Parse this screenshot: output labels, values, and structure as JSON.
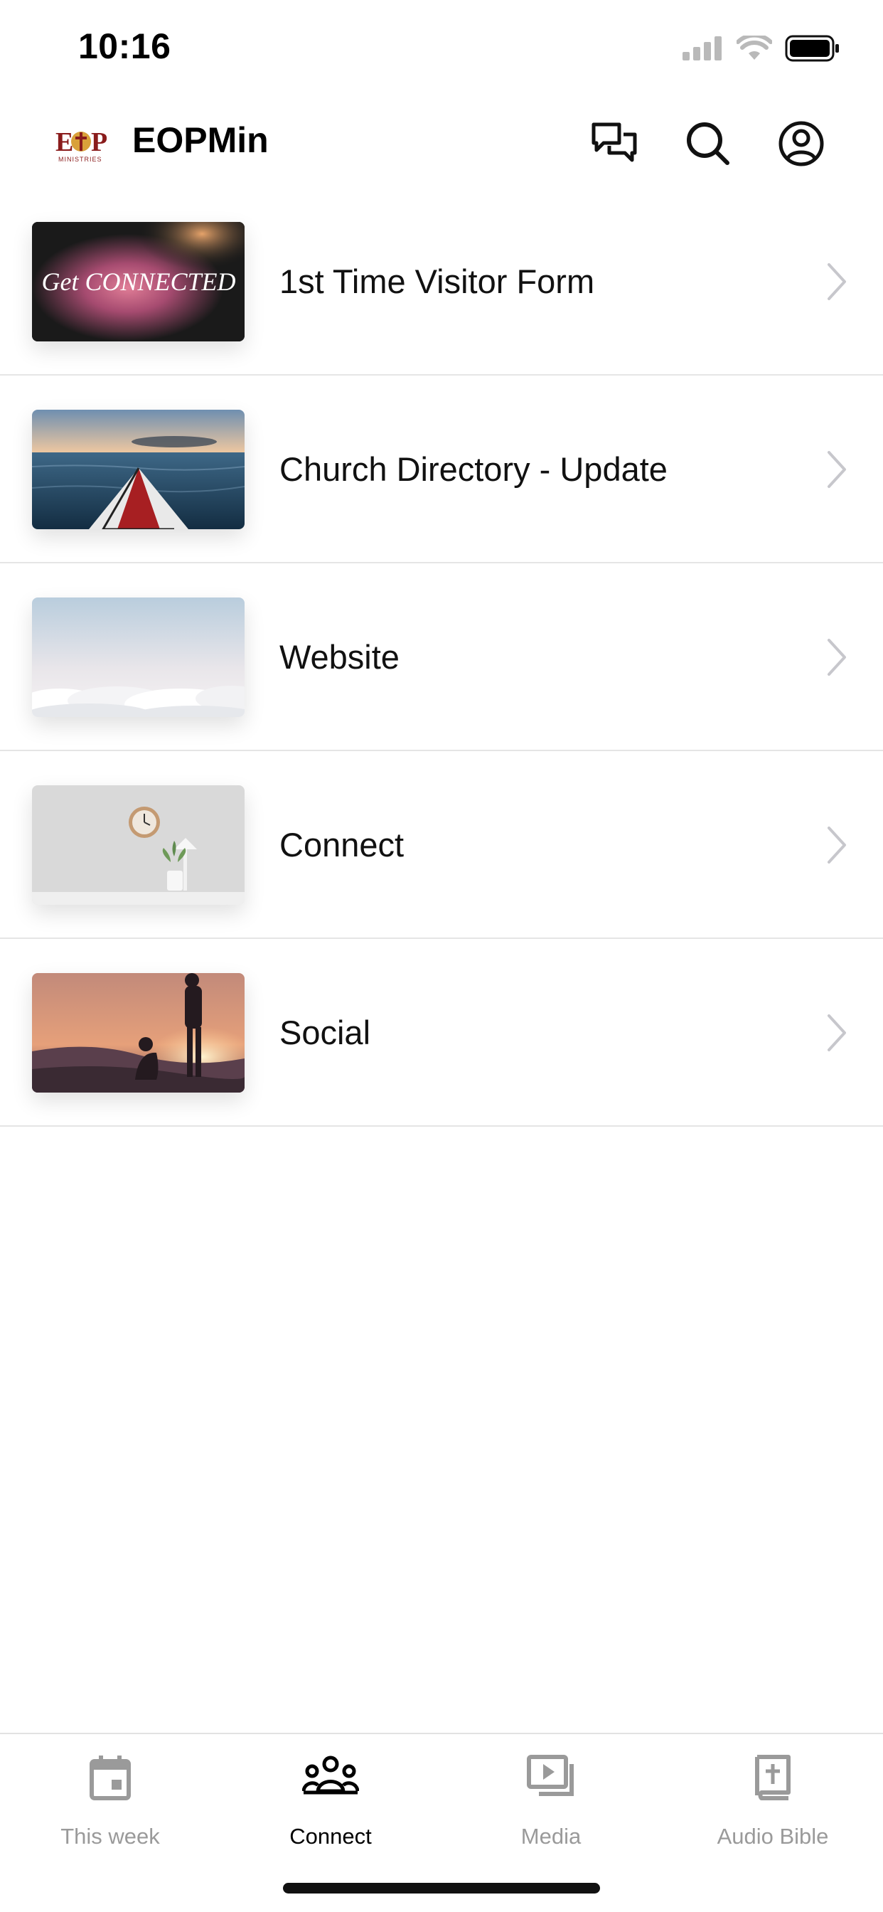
{
  "status_bar": {
    "time": "10:16",
    "icons": [
      "signal-icon",
      "wifi-icon",
      "battery-icon"
    ]
  },
  "header": {
    "logo_text": "EOP",
    "logo_subtext": "MINISTRIES",
    "title": "EOPMin",
    "actions": [
      "chat-icon",
      "search-icon",
      "account-icon"
    ]
  },
  "list": {
    "items": [
      {
        "label": "1st Time Visitor Form",
        "thumb_text": "Get CONNECTED"
      },
      {
        "label": "Church Directory - Update"
      },
      {
        "label": "Website"
      },
      {
        "label": "Connect"
      },
      {
        "label": "Social"
      }
    ]
  },
  "tabs": [
    {
      "label": "This week",
      "icon": "calendar-icon",
      "active": false
    },
    {
      "label": "Connect",
      "icon": "people-icon",
      "active": true
    },
    {
      "label": "Media",
      "icon": "media-icon",
      "active": false
    },
    {
      "label": "Audio Bible",
      "icon": "bible-icon",
      "active": false
    }
  ],
  "colors": {
    "active_tab": "#000000",
    "inactive_tab": "#9a9a9a",
    "chevron": "#c7c7cc",
    "divider": "#e5e5e5"
  }
}
